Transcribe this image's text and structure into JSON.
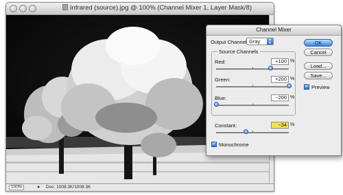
{
  "document": {
    "title": "Infrared (source).jpg @ 100% (Channel Mixer 1, Layer Mask/8)",
    "zoom": "100%",
    "doc_size": "Doc: 1008.3K/1008.3K"
  },
  "dialog": {
    "title": "Channel Mixer",
    "output_channel_label": "Output Channel:",
    "output_channel_value": "Gray",
    "source_channels_label": "Source Channels",
    "channels": [
      {
        "label": "Red:",
        "value": "+100",
        "unit": "%",
        "percent": 100
      },
      {
        "label": "Green:",
        "value": "+200",
        "unit": "%",
        "percent": 200
      },
      {
        "label": "Blue:",
        "value": "−200",
        "unit": "%",
        "percent": -200
      }
    ],
    "constant": {
      "label": "Constant:",
      "value": "−34",
      "unit": "%",
      "percent": -34
    },
    "monochrome_label": "Monochrome",
    "monochrome_checked": true,
    "preview_label": "Preview",
    "preview_checked": true,
    "buttons": {
      "ok": "OK",
      "cancel": "Cancel",
      "load": "Load...",
      "save": "Save..."
    }
  }
}
